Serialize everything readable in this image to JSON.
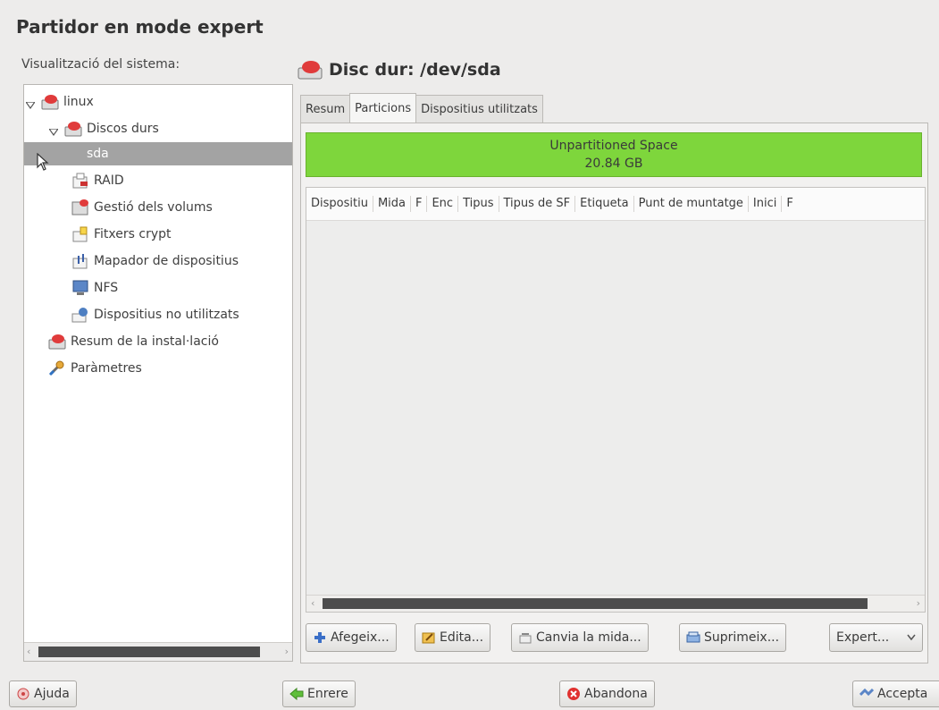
{
  "window": {
    "title": "Partidor en mode expert"
  },
  "tree": {
    "label": "Visualització del sistema:",
    "items": [
      {
        "label": "linux"
      },
      {
        "label": "Discos durs"
      },
      {
        "label": "sda"
      },
      {
        "label": "RAID"
      },
      {
        "label": "Gestió dels volums"
      },
      {
        "label": "Fitxers crypt"
      },
      {
        "label": "Mapador de dispositius"
      },
      {
        "label": "NFS"
      },
      {
        "label": "Dispositius no utilitzats"
      },
      {
        "label": "Resum de la instal·lació"
      },
      {
        "label": "Paràmetres"
      }
    ]
  },
  "disk": {
    "title": "Disc dur: /dev/sda"
  },
  "tabs": [
    {
      "label": "Resum"
    },
    {
      "label": "Particions",
      "active": true
    },
    {
      "label": "Dispositius utilitzats"
    }
  ],
  "unpartitioned": {
    "label": "Unpartitioned Space",
    "size": "20.84 GB",
    "color": "#7ed63c"
  },
  "table": {
    "columns": [
      "Dispositiu",
      "Mida",
      "F",
      "Enc",
      "Tipus",
      "Tipus de SF",
      "Etiqueta",
      "Punt de muntatge",
      "Inici",
      "F"
    ],
    "rows": []
  },
  "actions": {
    "add": "Afegeix...",
    "edit": "Edita...",
    "resize": "Canvia la mida...",
    "delete": "Suprimeix...",
    "expert": "Expert..."
  },
  "footer": {
    "help": "Ajuda",
    "back": "Enrere",
    "abort": "Abandona",
    "accept": "Accepta"
  },
  "icons": {
    "disk": "hard-disk-icon",
    "raid": "raid-icon",
    "lvm": "volume-management-icon",
    "crypt": "crypt-file-icon",
    "dm": "device-mapper-icon",
    "nfs": "nfs-icon",
    "unused": "unused-devices-icon",
    "settings": "settings-icon"
  }
}
